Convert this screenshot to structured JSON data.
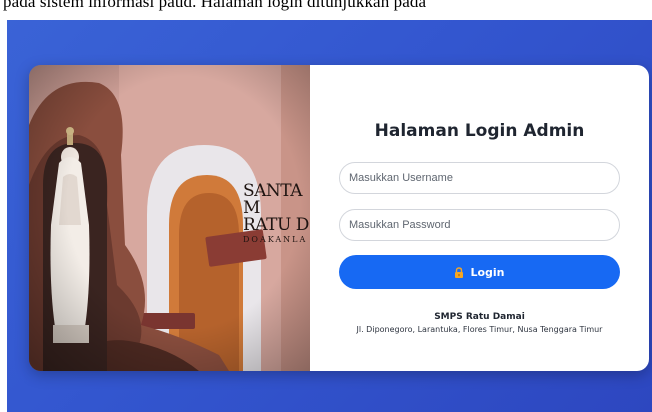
{
  "caption": {
    "text": "pada sistem informasi paud. Halaman login ditunjukkan pada"
  },
  "photo": {
    "sign_line1": "SANTA M",
    "sign_line2": "RATU D",
    "sign_line3": "DOAKANLA"
  },
  "login": {
    "title": "Halaman Login Admin",
    "username_placeholder": "Masukkan Username",
    "password_placeholder": "Masukkan Password",
    "button_label": "Login",
    "button_icon": "lock-icon"
  },
  "footer": {
    "school_name": "SMPS Ratu Damai",
    "address": "Jl. Diponegoro, Larantuka, Flores Timur, Nusa Tenggara Timur"
  },
  "colors": {
    "background": "#3356cf",
    "button": "#1769f3",
    "lock": "#f5a623"
  }
}
